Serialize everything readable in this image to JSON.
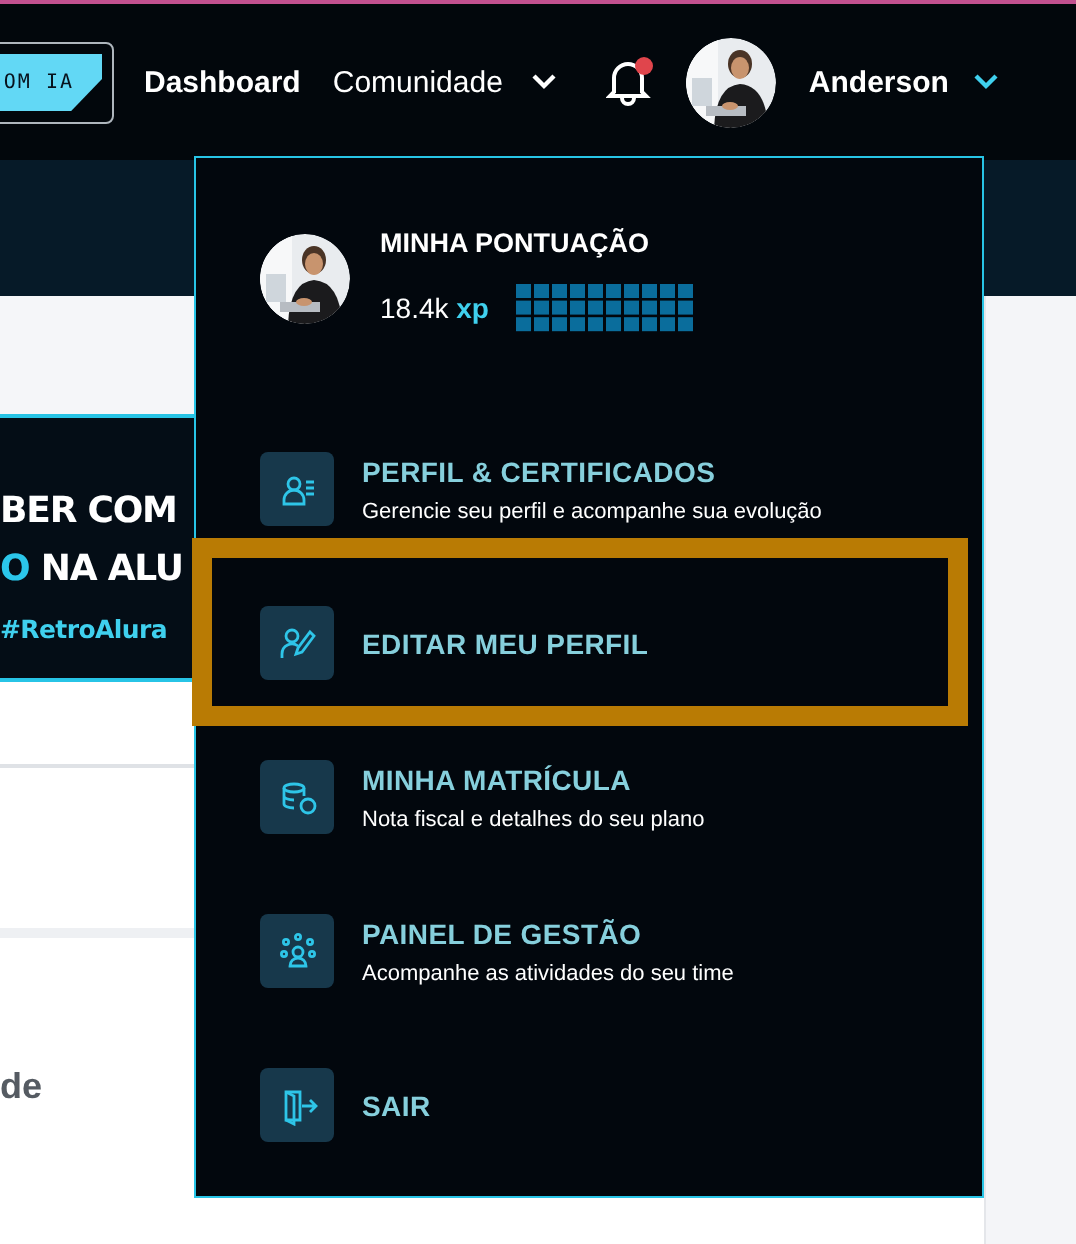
{
  "header": {
    "ai_button": "OM IA",
    "nav": [
      {
        "label": "Dashboard",
        "kind": "link"
      },
      {
        "label": "Comunidade",
        "kind": "dropdown"
      }
    ],
    "notifications": {
      "unread": true
    },
    "user": {
      "name": "Anderson",
      "expanded": true
    }
  },
  "background": {
    "banner": {
      "line_1": "BER COM",
      "line_2_accent": "O",
      "line_2": "NA ALU",
      "hashtag": "#RetroAlura"
    },
    "section_text": "de"
  },
  "menu": {
    "score_title": "MINHA PONTUAÇÃO",
    "xp": "18.4k",
    "xp_unit": "xp",
    "items": [
      {
        "kind": "profile",
        "title": "PERFIL & CERTIFICADOS",
        "subtitle": "Gerencie seu perfil e acompanhe sua evolução",
        "highlighted": false
      },
      {
        "kind": "edit",
        "title": "EDITAR MEU PERFIL",
        "highlighted": true
      },
      {
        "kind": "billing",
        "title": "MINHA MATRÍCULA",
        "subtitle": "Nota fiscal e detalhes do seu plano",
        "highlighted": false
      },
      {
        "kind": "team",
        "title": "PAINEL DE GESTÃO",
        "subtitle": "Acompanhe as atividades do seu time",
        "highlighted": false
      },
      {
        "kind": "logout",
        "title": "SAIR",
        "highlighted": false
      }
    ]
  }
}
